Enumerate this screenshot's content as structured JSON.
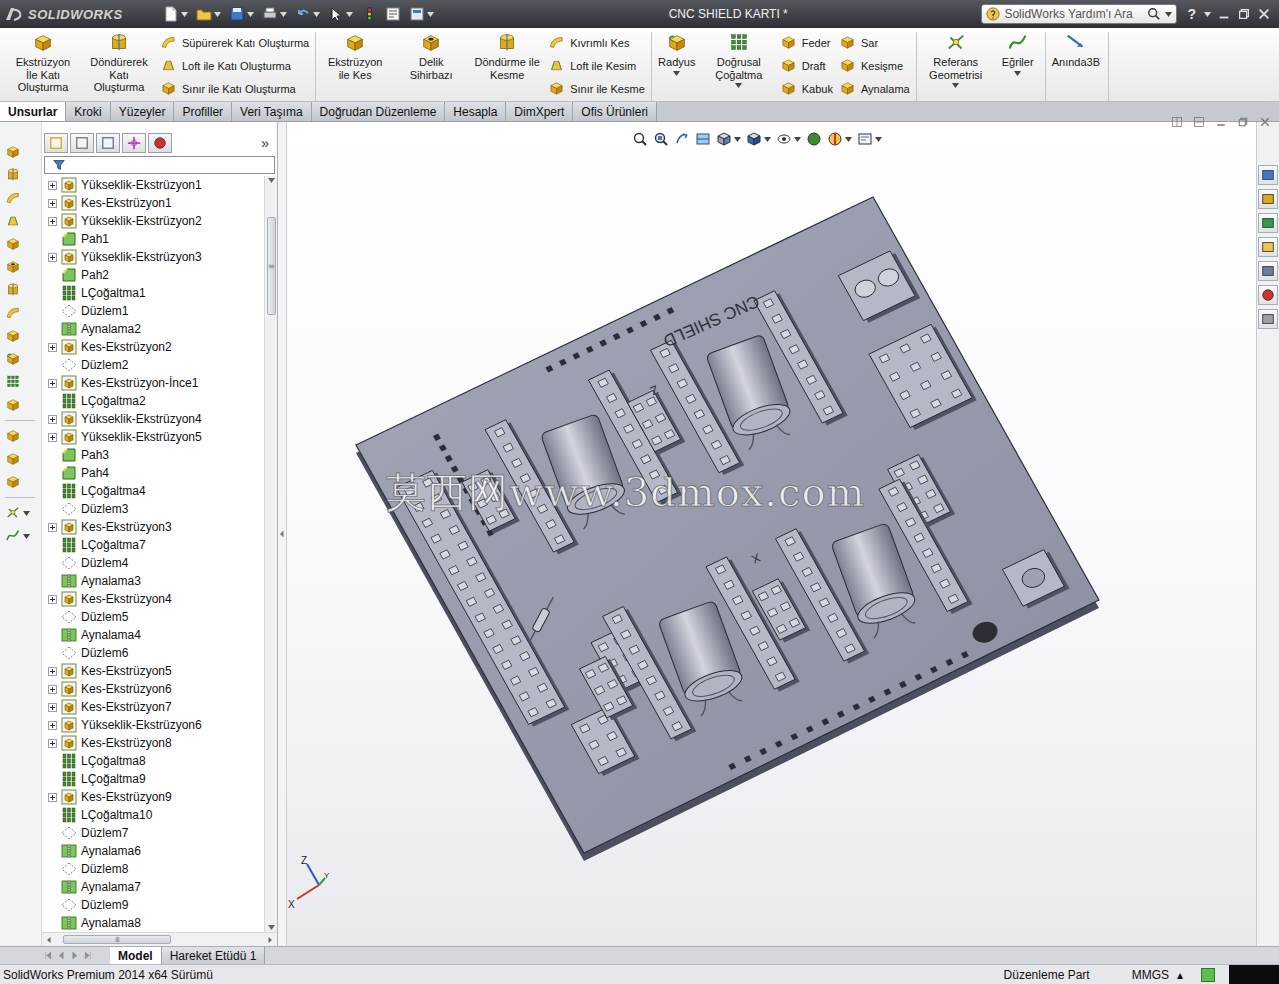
{
  "window": {
    "title": "CNC SHIELD KARTI *",
    "logo": "SOLIDWORKS"
  },
  "search": {
    "placeholder": "SolidWorks Yardım'ı Ara"
  },
  "help": "?",
  "ribbon": [
    [
      {
        "kind": "large",
        "label": "Ekstrüzyon İle Katı Oluşturma",
        "menu": false
      },
      {
        "kind": "large",
        "label": "Döndürerek Katı Oluşturma",
        "menu": false
      },
      {
        "kind": "stack",
        "items": [
          "Süpürerek Katı Oluşturma",
          "Loft ile Katı Oluşturma",
          "Sınır ile Katı Oluşturma"
        ]
      }
    ],
    [
      {
        "kind": "large",
        "label": "Ekstrüzyon ile Kes",
        "menu": false
      },
      {
        "kind": "large",
        "label": "Delik Sihirbazı",
        "menu": false
      },
      {
        "kind": "large",
        "label": "Döndürme ile Kesme",
        "menu": false
      },
      {
        "kind": "stack",
        "items": [
          "Kıvrımlı Kes",
          "Loft ile Kesim",
          "Sınır ile Kesme"
        ]
      }
    ],
    [
      {
        "kind": "large",
        "label": "Radyus",
        "menu": true
      },
      {
        "kind": "large",
        "label": "Doğrusal Çoğaltma",
        "menu": true
      },
      {
        "kind": "stack",
        "items": [
          "Feder",
          "Draft",
          "Kabuk"
        ]
      },
      {
        "kind": "stack",
        "items": [
          "Sar",
          "Kesişme",
          "Aynalama"
        ]
      }
    ],
    [
      {
        "kind": "large",
        "label": "Referans Geometrisi",
        "menu": true
      },
      {
        "kind": "large",
        "label": "Eğriler",
        "menu": true
      }
    ],
    [
      {
        "kind": "large",
        "label": "Anında3B",
        "menu": false
      }
    ]
  ],
  "tabs": [
    {
      "label": "Unsurlar",
      "selected": true
    },
    {
      "label": "Kroki",
      "selected": false
    },
    {
      "label": "Yüzeyler",
      "selected": false
    },
    {
      "label": "Profiller",
      "selected": false
    },
    {
      "label": "Veri Taşıma",
      "selected": false
    },
    {
      "label": "Doğrudan Düzenleme",
      "selected": false
    },
    {
      "label": "Hesapla",
      "selected": false
    },
    {
      "label": "DimXpert",
      "selected": false
    },
    {
      "label": "Ofis Ürünleri",
      "selected": false
    }
  ],
  "tree": {
    "collapse": "»",
    "items": [
      {
        "label": "Yükseklik-Ekstrüzyon1",
        "kind": "extrude",
        "expandable": true
      },
      {
        "label": "Kes-Ekstrüzyon1",
        "kind": "cut",
        "expandable": true
      },
      {
        "label": "Yükseklik-Ekstrüzyon2",
        "kind": "extrude",
        "expandable": true
      },
      {
        "label": "Pah1",
        "kind": "chamfer",
        "expandable": false
      },
      {
        "label": "Yükseklik-Ekstrüzyon3",
        "kind": "extrude",
        "expandable": true
      },
      {
        "label": "Pah2",
        "kind": "chamfer",
        "expandable": false
      },
      {
        "label": "LÇoğaltma1",
        "kind": "pattern",
        "expandable": false
      },
      {
        "label": "Düzlem1",
        "kind": "plane",
        "expandable": false
      },
      {
        "label": "Aynalama2",
        "kind": "mirror",
        "expandable": false
      },
      {
        "label": "Kes-Ekstrüzyon2",
        "kind": "cut",
        "expandable": true
      },
      {
        "label": "Düzlem2",
        "kind": "plane",
        "expandable": false
      },
      {
        "label": "Kes-Ekstrüzyon-İnce1",
        "kind": "cut",
        "expandable": true
      },
      {
        "label": "LÇoğaltma2",
        "kind": "pattern",
        "expandable": false
      },
      {
        "label": "Yükseklik-Ekstrüzyon4",
        "kind": "extrude",
        "expandable": true
      },
      {
        "label": "Yükseklik-Ekstrüzyon5",
        "kind": "extrude",
        "expandable": true
      },
      {
        "label": "Pah3",
        "kind": "chamfer",
        "expandable": false
      },
      {
        "label": "Pah4",
        "kind": "chamfer",
        "expandable": false
      },
      {
        "label": "LÇoğaltma4",
        "kind": "pattern",
        "expandable": false
      },
      {
        "label": "Düzlem3",
        "kind": "plane",
        "expandable": false
      },
      {
        "label": "Kes-Ekstrüzyon3",
        "kind": "cut",
        "expandable": true
      },
      {
        "label": "LÇoğaltma7",
        "kind": "pattern",
        "expandable": false
      },
      {
        "label": "Düzlem4",
        "kind": "plane",
        "expandable": false
      },
      {
        "label": "Aynalama3",
        "kind": "mirror",
        "expandable": false
      },
      {
        "label": "Kes-Ekstrüzyon4",
        "kind": "cut",
        "expandable": true
      },
      {
        "label": "Düzlem5",
        "kind": "plane",
        "expandable": false
      },
      {
        "label": "Aynalama4",
        "kind": "mirror",
        "expandable": false
      },
      {
        "label": "Düzlem6",
        "kind": "plane",
        "expandable": false
      },
      {
        "label": "Kes-Ekstrüzyon5",
        "kind": "cut",
        "expandable": true
      },
      {
        "label": "Kes-Ekstrüzyon6",
        "kind": "cut",
        "expandable": true
      },
      {
        "label": "Kes-Ekstrüzyon7",
        "kind": "cut",
        "expandable": true
      },
      {
        "label": "Yükseklik-Ekstrüzyon6",
        "kind": "extrude",
        "expandable": true
      },
      {
        "label": "Kes-Ekstrüzyon8",
        "kind": "cut",
        "expandable": true
      },
      {
        "label": "LÇoğaltma8",
        "kind": "pattern",
        "expandable": false
      },
      {
        "label": "LÇoğaltma9",
        "kind": "pattern",
        "expandable": false
      },
      {
        "label": "Kes-Ekstrüzyon9",
        "kind": "cut",
        "expandable": true
      },
      {
        "label": "LÇoğaltma10",
        "kind": "pattern",
        "expandable": false
      },
      {
        "label": "Düzlem7",
        "kind": "plane",
        "expandable": false
      },
      {
        "label": "Aynalama6",
        "kind": "mirror",
        "expandable": false
      },
      {
        "label": "Düzlem8",
        "kind": "plane",
        "expandable": false
      },
      {
        "label": "Aynalama7",
        "kind": "mirror",
        "expandable": false
      },
      {
        "label": "Düzlem9",
        "kind": "plane",
        "expandable": false
      },
      {
        "label": "Aynalama8",
        "kind": "mirror",
        "expandable": false
      }
    ]
  },
  "graphics": {
    "model": {
      "label": "CNC SHIELD",
      "marks": [
        "Y",
        "Z",
        "X"
      ]
    },
    "triad": [
      "Z",
      "X",
      "Y"
    ],
    "watermark": "莫西网www.3dmox.com"
  },
  "bottom_tabs": [
    {
      "label": "Model",
      "selected": true
    },
    {
      "label": "Hareket Etüdü 1",
      "selected": false
    }
  ],
  "status_bar": {
    "version": "SolidWorks Premium 2014 x64 Sürümü",
    "mode": "Düzenleme Part",
    "units": "MMGS",
    "units_menu": "▴"
  }
}
